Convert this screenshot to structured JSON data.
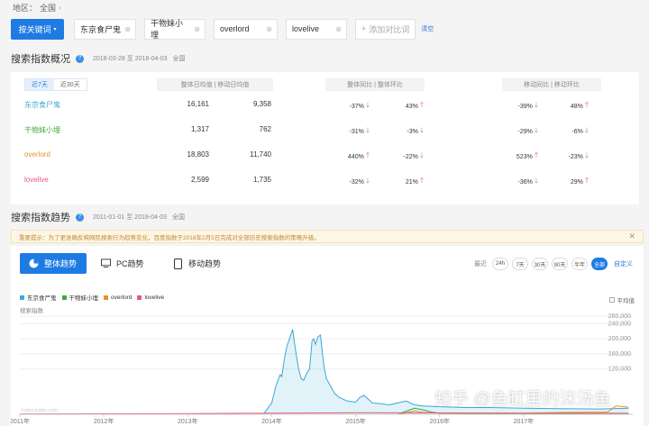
{
  "region": {
    "label": "地区：",
    "value": "全国",
    "chevron_icon": "chevron-right-icon"
  },
  "keywords": {
    "button_label": "按关键词",
    "tags": [
      "东京食尸鬼",
      "干物妹小埋",
      "overlord",
      "lovelive"
    ],
    "add_label": "添加对比词",
    "clear_label": "清空"
  },
  "overview": {
    "title": "搜索指数概况",
    "date_range": "2018-03-28 至 2018-04-03",
    "region": "全国",
    "tabs": [
      "近7天",
      "近30天"
    ],
    "col_headers": [
      "整体日均值",
      "移动日均值",
      "整体同比",
      "整体环比",
      "移动同比",
      "移动环比"
    ],
    "rows": [
      {
        "keyword": "东京食尸鬼",
        "color": "#3aa8d8",
        "overall_avg": "16,161",
        "mobile_avg": "9,358",
        "overall_yoy": "-37%",
        "overall_yoy_dir": "down",
        "overall_mom": "43%",
        "overall_mom_dir": "up",
        "mobile_yoy": "-39%",
        "mobile_yoy_dir": "down",
        "mobile_mom": "48%",
        "mobile_mom_dir": "up"
      },
      {
        "keyword": "干物妹小埋",
        "color": "#41a93c",
        "overall_avg": "1,317",
        "mobile_avg": "762",
        "overall_yoy": "-31%",
        "overall_yoy_dir": "down",
        "overall_mom": "-3%",
        "overall_mom_dir": "down",
        "mobile_yoy": "-29%",
        "mobile_yoy_dir": "down",
        "mobile_mom": "-6%",
        "mobile_mom_dir": "down"
      },
      {
        "keyword": "overlord",
        "color": "#e8922a",
        "overall_avg": "18,803",
        "mobile_avg": "11,740",
        "overall_yoy": "440%",
        "overall_yoy_dir": "up",
        "overall_mom": "-22%",
        "overall_mom_dir": "down",
        "mobile_yoy": "523%",
        "mobile_yoy_dir": "up",
        "mobile_mom": "-23%",
        "mobile_mom_dir": "down"
      },
      {
        "keyword": "lovelive",
        "color": "#e55a7b",
        "overall_avg": "2,599",
        "mobile_avg": "1,735",
        "overall_yoy": "-32%",
        "overall_yoy_dir": "down",
        "overall_mom": "21%",
        "overall_mom_dir": "up",
        "mobile_yoy": "-36%",
        "mobile_yoy_dir": "down",
        "mobile_mom": "29%",
        "mobile_mom_dir": "up"
      }
    ]
  },
  "trend": {
    "title": "搜索指数趋势",
    "date_range": "2011-01-01 至 2018-04-03",
    "region": "全国",
    "notice": "重要提示：为了更准确反映网民搜索行为趋势变化，百度指数于2018年2月5日完成对全部历史搜索指数的策略升级。",
    "tabs": [
      "整体趋势",
      "PC趋势",
      "移动趋势"
    ],
    "range_label": "最近",
    "ranges": [
      "24h",
      "7天",
      "30天",
      "90天",
      "半年",
      "全部"
    ],
    "active_range": "全部",
    "custom_label": "自定义",
    "avg_label": "平均值"
  },
  "chart_data": {
    "type": "line",
    "ylabel": "搜索指数",
    "ylim": [
      0,
      260000
    ],
    "y_ticks": [
      "260,000",
      "240,000",
      "200,000",
      "160,000",
      "120,000"
    ],
    "x_ticks": [
      "2011年",
      "2012年",
      "2013年",
      "2014年",
      "2015年",
      "2016年",
      "2017年"
    ],
    "legend": [
      "东京食尸鬼",
      "干物妹小埋",
      "overlord",
      "lovelive"
    ],
    "series": [
      {
        "name": "东京食尸鬼",
        "color": "#3aa8d8",
        "x": [
          2011.0,
          2013.9,
          2014.0,
          2014.05,
          2014.1,
          2014.12,
          2014.15,
          2014.18,
          2014.22,
          2014.25,
          2014.28,
          2014.32,
          2014.35,
          2014.38,
          2014.42,
          2014.45,
          2014.48,
          2014.5,
          2014.52,
          2014.55,
          2014.58,
          2014.62,
          2014.65,
          2014.7,
          2014.75,
          2014.8,
          2014.85,
          2014.9,
          2015.0,
          2015.05,
          2015.1,
          2015.15,
          2015.2,
          2015.3,
          2015.4,
          2015.5,
          2015.6,
          2015.7,
          2015.8,
          2016.0,
          2016.3,
          2016.6,
          2017.0,
          2017.4,
          2017.9,
          2018.25
        ],
        "values": [
          0,
          0,
          30000,
          75000,
          105000,
          100000,
          145000,
          180000,
          205000,
          225000,
          175000,
          120000,
          95000,
          90000,
          110000,
          120000,
          195000,
          200000,
          185000,
          205000,
          210000,
          130000,
          95000,
          75000,
          55000,
          45000,
          40000,
          35000,
          32000,
          45000,
          50000,
          40000,
          30000,
          28000,
          25000,
          30000,
          35000,
          25000,
          22000,
          20000,
          18000,
          18000,
          16000,
          15000,
          14000,
          16000
        ]
      },
      {
        "name": "干物妹小埋",
        "color": "#41a93c",
        "x": [
          2011.0,
          2015.5,
          2015.6,
          2015.7,
          2015.8,
          2015.9,
          2016.0,
          2016.5,
          2017.0,
          2018.25
        ],
        "values": [
          0,
          0,
          8000,
          16000,
          12000,
          6000,
          3000,
          2000,
          2000,
          1300
        ]
      },
      {
        "name": "overlord",
        "color": "#e8922a",
        "x": [
          2011.0,
          2015.5,
          2015.6,
          2015.7,
          2015.8,
          2016.0,
          2017.0,
          2017.5,
          2018.0,
          2018.1,
          2018.25
        ],
        "values": [
          0,
          0,
          4000,
          9000,
          5000,
          3000,
          3000,
          5000,
          6000,
          22000,
          18800
        ]
      },
      {
        "name": "lovelive",
        "color": "#e55a7b",
        "x": [
          2011.0,
          2012.0,
          2013.0,
          2014.0,
          2015.0,
          2016.0,
          2017.0,
          2018.25
        ],
        "values": [
          1000,
          1500,
          2000,
          3000,
          4000,
          3500,
          3000,
          2600
        ]
      }
    ]
  },
  "watermark": "知乎 @鱼缸里的沫汤鱼",
  "chart_credit": "index.baidu.com"
}
